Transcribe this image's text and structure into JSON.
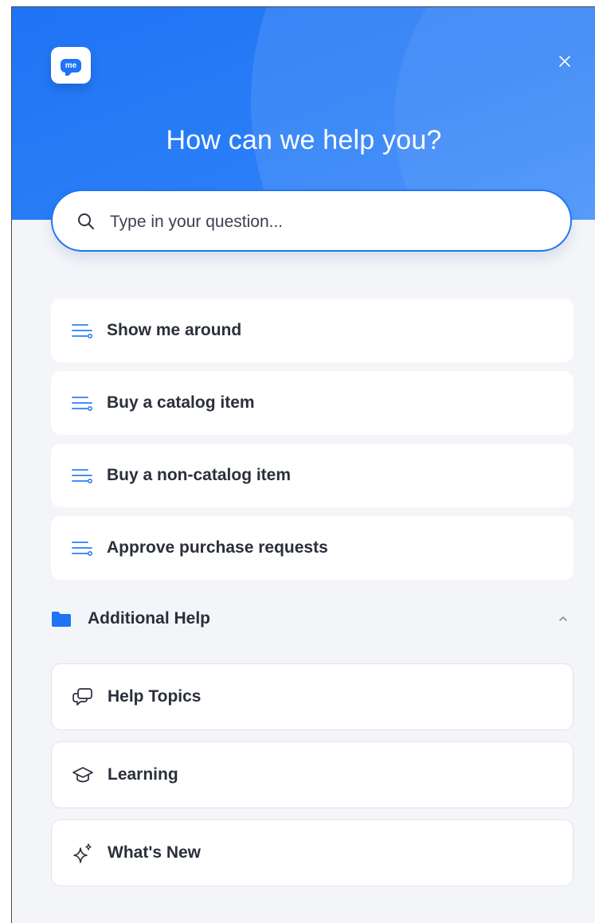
{
  "header": {
    "title": "How can we help you?",
    "logo_text": "me",
    "brand_color": "#1f74f5"
  },
  "search": {
    "placeholder": "Type in your question..."
  },
  "walkthroughs": [
    {
      "label": "Show me around",
      "icon": "flow-list-icon"
    },
    {
      "label": "Buy a catalog item",
      "icon": "flow-list-icon"
    },
    {
      "label": "Buy a non-catalog item",
      "icon": "flow-list-icon"
    },
    {
      "label": "Approve purchase requests",
      "icon": "flow-list-icon"
    }
  ],
  "additional_help": {
    "title": "Additional Help",
    "expanded": true,
    "items": [
      {
        "label": "Help Topics",
        "icon": "chat-bubbles-icon"
      },
      {
        "label": "Learning",
        "icon": "graduation-cap-icon"
      },
      {
        "label": "What's New",
        "icon": "sparkle-icon"
      }
    ]
  }
}
